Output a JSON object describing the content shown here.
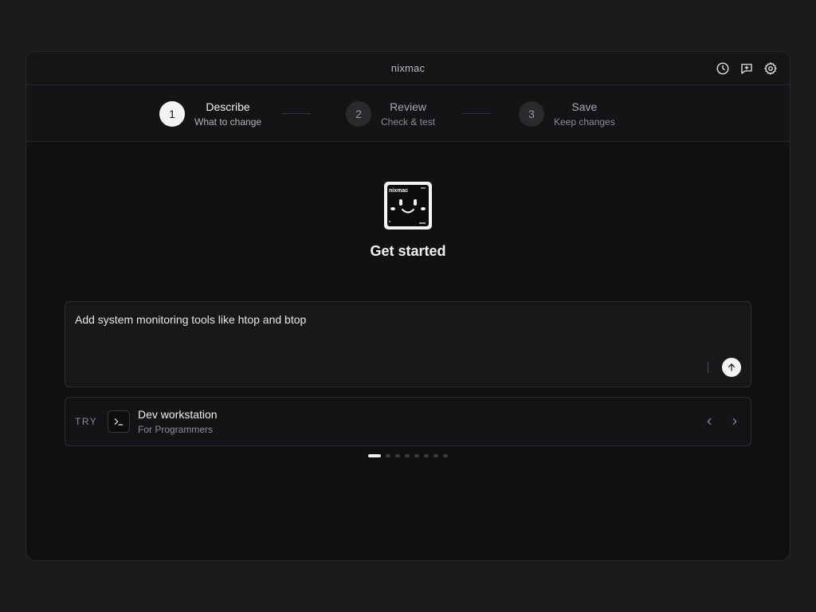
{
  "window": {
    "title": "nixmac"
  },
  "header_actions": [
    {
      "name": "history-icon",
      "label": "History"
    },
    {
      "name": "feedback-icon",
      "label": "Feedback"
    },
    {
      "name": "settings-icon",
      "label": "Settings"
    }
  ],
  "steps": [
    {
      "number": "1",
      "label": "Describe",
      "sub": "What to change",
      "active": true
    },
    {
      "number": "2",
      "label": "Review",
      "sub": "Check & test",
      "active": false
    },
    {
      "number": "3",
      "label": "Save",
      "sub": "Keep changes",
      "active": false
    }
  ],
  "logo": {
    "text": "nixmac"
  },
  "main": {
    "heading": "Get started"
  },
  "prompt": {
    "value": "Add system monitoring tools like htop and btop"
  },
  "suggestion": {
    "try_label": "TRY",
    "icon": "terminal-icon",
    "title": "Dev workstation",
    "subtitle": "For Programmers",
    "page_index": 0,
    "page_count": 8
  },
  "colors": {
    "background": "#1b1b1d",
    "window": "#111112",
    "accent": "#f4f4f4"
  }
}
